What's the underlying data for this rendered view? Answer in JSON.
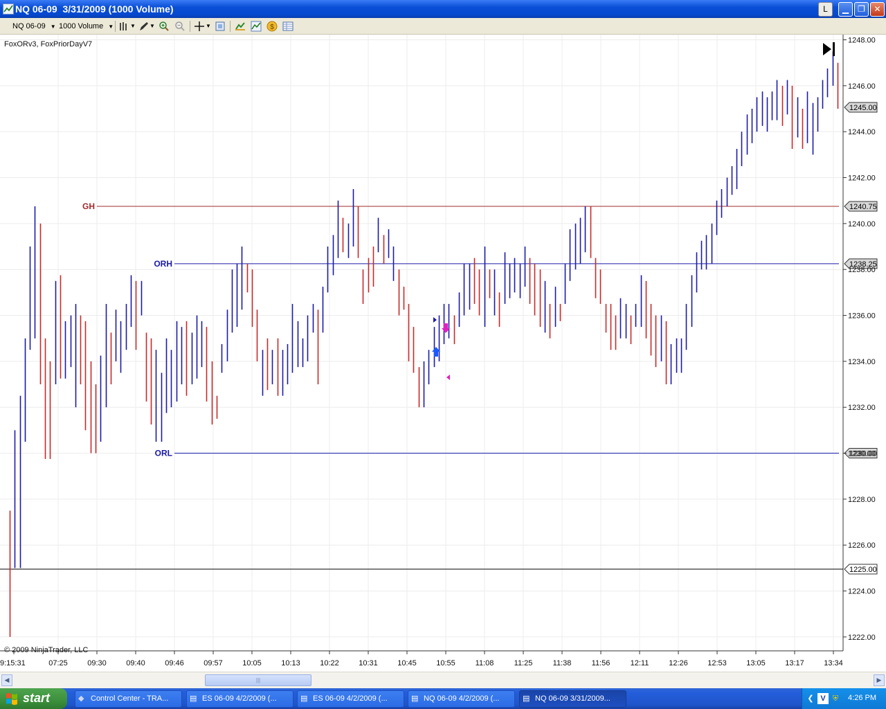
{
  "window": {
    "title": "NQ 06-09  3/31/2009 (1000 Volume)",
    "btn_l": "L",
    "btn_min": "▁",
    "btn_max": "❐",
    "btn_close": "✕"
  },
  "toolbar": {
    "instrument": "NQ 06-09",
    "period": "1000 Volume",
    "icons": [
      "bar-style-icon",
      "draw-pencil-icon",
      "zoom-in-icon",
      "zoom-out-icon",
      "crosshair-icon",
      "properties-icon",
      "strategy-icon",
      "indicators-icon",
      "order-icon",
      "data-box-icon"
    ]
  },
  "chart": {
    "indicator_label": "FoxORv3, FoxPriorDayV7",
    "copyright": "© 2009 NinjaTrader, LLC",
    "up_color": "#1a1aa8",
    "down_color": "#c82828",
    "price_labels": [
      "1248.00",
      "1246.00",
      "1244.00",
      "1242.00",
      "1240.00",
      "1238.00",
      "1236.00",
      "1234.00",
      "1232.00",
      "1230.00",
      "1228.00",
      "1226.00",
      "1224.00",
      "1222.00"
    ],
    "time_labels": [
      "9:15:31",
      "07:25",
      "09:30",
      "09:40",
      "09:46",
      "09:57",
      "10:05",
      "10:13",
      "10:22",
      "10:31",
      "10:45",
      "10:55",
      "11:08",
      "11:25",
      "11:38",
      "11:56",
      "12:11",
      "12:26",
      "12:53",
      "13:05",
      "13:17",
      "13:34"
    ],
    "levels": [
      {
        "name": "GH",
        "price": 1240.75,
        "label": "1240.75",
        "color": "#a02a2a"
      },
      {
        "name": "ORH",
        "price": 1238.25,
        "label": "1238.25",
        "color": "#1a1aa8"
      },
      {
        "name": "ORL",
        "price": 1230.0,
        "label": "1230.00",
        "color": "#1a1aa8"
      }
    ],
    "last_price": "1245.00",
    "crosshair_price": "1225.00"
  },
  "chart_data": {
    "type": "ohlc-bar",
    "ylim": [
      1221.5,
      1248.25
    ],
    "bars": [
      [
        1227.5,
        1222,
        1227.5,
        1222.5
      ],
      [
        1231,
        1225,
        1226,
        1231
      ],
      [
        1232.5,
        1225,
        1225,
        1232.5
      ],
      [
        1235,
        1230.5,
        1230.5,
        1235
      ],
      [
        1239,
        1234.5,
        1234.5,
        1239
      ],
      [
        1240.75,
        1235,
        1235,
        1240.75
      ],
      [
        1240,
        1233,
        1240,
        1233
      ],
      [
        1235,
        1229.75,
        1235,
        1230.5
      ],
      [
        1234,
        1229.75,
        1234,
        1229.75
      ],
      [
        1237.5,
        1233,
        1233,
        1237.5
      ],
      [
        1237.75,
        1233.25,
        1237.75,
        1233.5
      ],
      [
        1235.75,
        1233.25,
        1233.25,
        1235.75
      ],
      [
        1236,
        1233.75,
        1234,
        1236
      ],
      [
        1236.5,
        1232,
        1232,
        1234
      ],
      [
        1236,
        1233,
        1236,
        1233
      ],
      [
        1235.75,
        1231,
        1235.75,
        1231.5
      ],
      [
        1234,
        1230,
        1234,
        1230
      ],
      [
        1233,
        1230,
        1233,
        1230.25
      ],
      [
        1234.25,
        1230.5,
        1230.5,
        1234.25
      ],
      [
        1236.5,
        1232,
        1232,
        1236.5
      ],
      [
        1235.25,
        1233,
        1235.25,
        1233
      ],
      [
        1236.25,
        1234,
        1234,
        1236.25
      ],
      [
        1235.75,
        1233.5,
        1233.5,
        1235.75
      ],
      [
        1236.5,
        1234.5,
        1234.5,
        1236.5
      ],
      [
        1237.75,
        1235.5,
        1235.5,
        1237.75
      ],
      [
        1237.5,
        1234.5,
        1237.5,
        1234.5
      ],
      [
        1237.5,
        1236,
        1236,
        1237.5
      ],
      [
        1235.25,
        1232.25,
        1235.25,
        1232.25
      ],
      [
        1235,
        1231.25,
        1235,
        1231.25
      ],
      [
        1234.5,
        1230.5,
        1230.5,
        1234.5
      ],
      [
        1233.5,
        1230.5,
        1230.5,
        1233.5
      ],
      [
        1235,
        1231.75,
        1231.75,
        1235
      ],
      [
        1234.5,
        1232,
        1232,
        1234.5
      ],
      [
        1235.75,
        1232.25,
        1232.25,
        1235.75
      ],
      [
        1235.5,
        1233,
        1233,
        1235.5
      ],
      [
        1235.75,
        1232.5,
        1235.75,
        1232.5
      ],
      [
        1235.25,
        1233,
        1233,
        1235.25
      ],
      [
        1236,
        1233.25,
        1233.25,
        1236
      ],
      [
        1235.75,
        1233.75,
        1233.75,
        1235.75
      ],
      [
        1235.5,
        1232.25,
        1235.5,
        1232.25
      ],
      [
        1234,
        1231.25,
        1234,
        1231.75
      ],
      [
        1232.5,
        1231.5,
        1232.5,
        1231.5
      ],
      [
        1234.75,
        1233.5,
        1233.5,
        1234.75
      ],
      [
        1236.25,
        1234,
        1234,
        1236.25
      ],
      [
        1238,
        1235.25,
        1235.25,
        1238
      ],
      [
        1238.25,
        1235.5,
        1235.5,
        1238.25
      ],
      [
        1239,
        1236.25,
        1236.25,
        1239
      ],
      [
        1238.25,
        1237,
        1238.25,
        1237
      ],
      [
        1238,
        1235.5,
        1238,
        1235.5
      ],
      [
        1236.25,
        1234,
        1236.25,
        1234
      ],
      [
        1234.5,
        1232.5,
        1232.5,
        1234.5
      ],
      [
        1235,
        1232.75,
        1235,
        1232.75
      ],
      [
        1234.5,
        1233,
        1233,
        1234.5
      ],
      [
        1235,
        1232.5,
        1235,
        1233
      ],
      [
        1234.5,
        1232.5,
        1232.5,
        1234.5
      ],
      [
        1234.75,
        1233,
        1233,
        1234.75
      ],
      [
        1236.5,
        1233.5,
        1233.5,
        1236.5
      ],
      [
        1235.75,
        1233.75,
        1233.75,
        1235.75
      ],
      [
        1235,
        1233.75,
        1233.75,
        1235
      ],
      [
        1236,
        1234,
        1234,
        1236
      ],
      [
        1236.5,
        1235.25,
        1235.25,
        1236.5
      ],
      [
        1236.25,
        1233,
        1236.25,
        1233
      ],
      [
        1237.25,
        1235.25,
        1235.25,
        1237.25
      ],
      [
        1239,
        1237,
        1237,
        1239
      ],
      [
        1239.5,
        1237.75,
        1237.75,
        1239.5
      ],
      [
        1241,
        1238.5,
        1238.5,
        1241
      ],
      [
        1240.25,
        1238.75,
        1240.25,
        1238.75
      ],
      [
        1240,
        1238.5,
        1238.5,
        1240
      ],
      [
        1241.5,
        1239,
        1239,
        1241.5
      ],
      [
        1240.75,
        1238.5,
        1240.75,
        1238.5
      ],
      [
        1238,
        1236.5,
        1238,
        1236.5
      ],
      [
        1238.5,
        1237,
        1238.5,
        1237
      ],
      [
        1239,
        1237.25,
        1239,
        1237.25
      ],
      [
        1240.25,
        1238.75,
        1238.75,
        1240.25
      ],
      [
        1239.5,
        1238.25,
        1239.5,
        1238.25
      ],
      [
        1239.75,
        1238.5,
        1238.5,
        1239.75
      ],
      [
        1239,
        1237.5,
        1238,
        1239
      ],
      [
        1238,
        1236,
        1238,
        1236
      ],
      [
        1237.25,
        1236.25,
        1237.25,
        1236.25
      ],
      [
        1236.5,
        1234,
        1236.5,
        1234
      ],
      [
        1235.5,
        1233.5,
        1235.5,
        1233.5
      ],
      [
        1233.75,
        1232,
        1233.75,
        1232
      ],
      [
        1234,
        1232,
        1232,
        1234
      ],
      [
        1234.5,
        1233,
        1233,
        1234.5
      ],
      [
        1235.5,
        1233.75,
        1233.75,
        1235.5
      ],
      [
        1236,
        1234,
        1234,
        1236
      ],
      [
        1236.5,
        1234.75,
        1234.75,
        1236.5
      ],
      [
        1236.5,
        1235,
        1235,
        1236.5
      ],
      [
        1236,
        1234.75,
        1236,
        1234.75
      ],
      [
        1237,
        1235.5,
        1235.5,
        1237
      ],
      [
        1238.25,
        1236,
        1236,
        1238.25
      ],
      [
        1238.25,
        1236.25,
        1236.25,
        1238.25
      ],
      [
        1238.5,
        1236.5,
        1238.5,
        1236.5
      ],
      [
        1238,
        1236,
        1238,
        1236
      ],
      [
        1239,
        1235.5,
        1235.5,
        1239
      ],
      [
        1238,
        1236.75,
        1238,
        1236.75
      ],
      [
        1238,
        1236,
        1236,
        1238
      ],
      [
        1237,
        1235.5,
        1237,
        1235.5
      ],
      [
        1238.75,
        1236.5,
        1236.5,
        1238.75
      ],
      [
        1238.25,
        1236.75,
        1236.75,
        1238.25
      ],
      [
        1238.5,
        1237,
        1237,
        1238.5
      ],
      [
        1238.25,
        1236.75,
        1236.75,
        1238.25
      ],
      [
        1239,
        1237.25,
        1238.25,
        1239
      ],
      [
        1238.5,
        1236.5,
        1238.5,
        1236.5
      ],
      [
        1238.25,
        1236,
        1238.25,
        1236
      ],
      [
        1238,
        1235.5,
        1238,
        1235.75
      ],
      [
        1237.5,
        1235.25,
        1235.25,
        1237.5
      ],
      [
        1236.5,
        1235,
        1236.5,
        1235
      ],
      [
        1237.25,
        1235.5,
        1235.5,
        1237.25
      ],
      [
        1236.5,
        1235.75,
        1236.5,
        1235.75
      ],
      [
        1238.25,
        1236.5,
        1236.5,
        1238.25
      ],
      [
        1239.75,
        1237.5,
        1237.5,
        1239.75
      ],
      [
        1240,
        1238,
        1238,
        1240
      ],
      [
        1240.25,
        1238.25,
        1238.25,
        1240.25
      ],
      [
        1240.75,
        1238.75,
        1238.75,
        1240.75
      ],
      [
        1240.75,
        1238.5,
        1240.75,
        1238.5
      ],
      [
        1238.5,
        1236.75,
        1238.5,
        1236.75
      ],
      [
        1238,
        1236.5,
        1238,
        1236.5
      ],
      [
        1236.5,
        1235.25,
        1236.5,
        1235.25
      ],
      [
        1236.5,
        1234.5,
        1236.5,
        1234.5
      ],
      [
        1236,
        1234.5,
        1236,
        1234.5
      ],
      [
        1236.75,
        1235,
        1235,
        1236.75
      ],
      [
        1236.5,
        1235,
        1235,
        1236.5
      ],
      [
        1236,
        1234.75,
        1236,
        1234.75
      ],
      [
        1236.5,
        1235.5,
        1235.5,
        1236.5
      ],
      [
        1237.75,
        1235.5,
        1235.5,
        1237.75
      ],
      [
        1237.5,
        1235,
        1237.5,
        1235
      ],
      [
        1236.5,
        1234.25,
        1236.5,
        1234.25
      ],
      [
        1236,
        1233.75,
        1236,
        1233.75
      ],
      [
        1236,
        1234,
        1234,
        1236
      ],
      [
        1235.75,
        1233,
        1235.75,
        1233
      ],
      [
        1234.75,
        1233,
        1233,
        1234.75
      ],
      [
        1235,
        1233.5,
        1233.5,
        1235
      ],
      [
        1235,
        1233.5,
        1233.5,
        1235
      ],
      [
        1236.5,
        1234.5,
        1234.5,
        1236.5
      ],
      [
        1237.75,
        1235.5,
        1235.5,
        1237.75
      ],
      [
        1238.75,
        1237,
        1237,
        1238.75
      ],
      [
        1239.25,
        1238,
        1238,
        1239.25
      ],
      [
        1239.5,
        1238,
        1238,
        1239.5
      ],
      [
        1240,
        1238.25,
        1238.25,
        1240
      ],
      [
        1241,
        1239.5,
        1239.5,
        1241
      ],
      [
        1241.5,
        1240.25,
        1240.25,
        1241.5
      ],
      [
        1242,
        1240.75,
        1240.75,
        1242
      ],
      [
        1242.5,
        1241.25,
        1241.25,
        1242.5
      ],
      [
        1243.25,
        1241.5,
        1241.5,
        1243.25
      ],
      [
        1244,
        1242.5,
        1242.5,
        1244
      ],
      [
        1244.75,
        1243,
        1243,
        1244.75
      ],
      [
        1245,
        1243.5,
        1243.5,
        1245
      ],
      [
        1245.5,
        1244,
        1244,
        1245.5
      ],
      [
        1245.75,
        1244.25,
        1244.25,
        1245.75
      ],
      [
        1245.5,
        1244,
        1244,
        1245.5
      ],
      [
        1245.75,
        1244.5,
        1244.5,
        1245.75
      ],
      [
        1246.25,
        1244.5,
        1244.5,
        1246.25
      ],
      [
        1246,
        1244.25,
        1246,
        1244.25
      ],
      [
        1246.25,
        1244.75,
        1244.75,
        1246.25
      ],
      [
        1246,
        1243.25,
        1246,
        1243.25
      ],
      [
        1245.5,
        1243.75,
        1243.75,
        1245.5
      ],
      [
        1245,
        1243.25,
        1245,
        1243.25
      ],
      [
        1245.75,
        1243.5,
        1243.5,
        1245.75
      ],
      [
        1245.25,
        1243,
        1243,
        1245.25
      ],
      [
        1245.5,
        1244,
        1244,
        1245.5
      ],
      [
        1246.25,
        1245,
        1245,
        1246.25
      ],
      [
        1246.75,
        1245.5,
        1245.5,
        1246.75
      ],
      [
        1247.5,
        1246,
        1246,
        1247.5
      ],
      [
        1247,
        1245,
        1247,
        1245
      ]
    ]
  },
  "scrollbar": {
    "left_arrow": "◀",
    "right_arrow": "▶",
    "thumb_grip": "|||"
  },
  "taskbar": {
    "start_label": "start",
    "tasks": [
      {
        "label": "Control Center - TRA...",
        "icon": "ninja-icon"
      },
      {
        "label": "ES 06-09  4/2/2009 (...",
        "icon": "chart-icon"
      },
      {
        "label": "ES 06-09  4/2/2009 (...",
        "icon": "chart-icon"
      },
      {
        "label": "NQ 06-09  4/2/2009 (...",
        "icon": "chart-icon"
      },
      {
        "label": "NQ 06-09  3/31/2009...",
        "icon": "chart-icon"
      }
    ],
    "clock": "4:26 PM"
  }
}
